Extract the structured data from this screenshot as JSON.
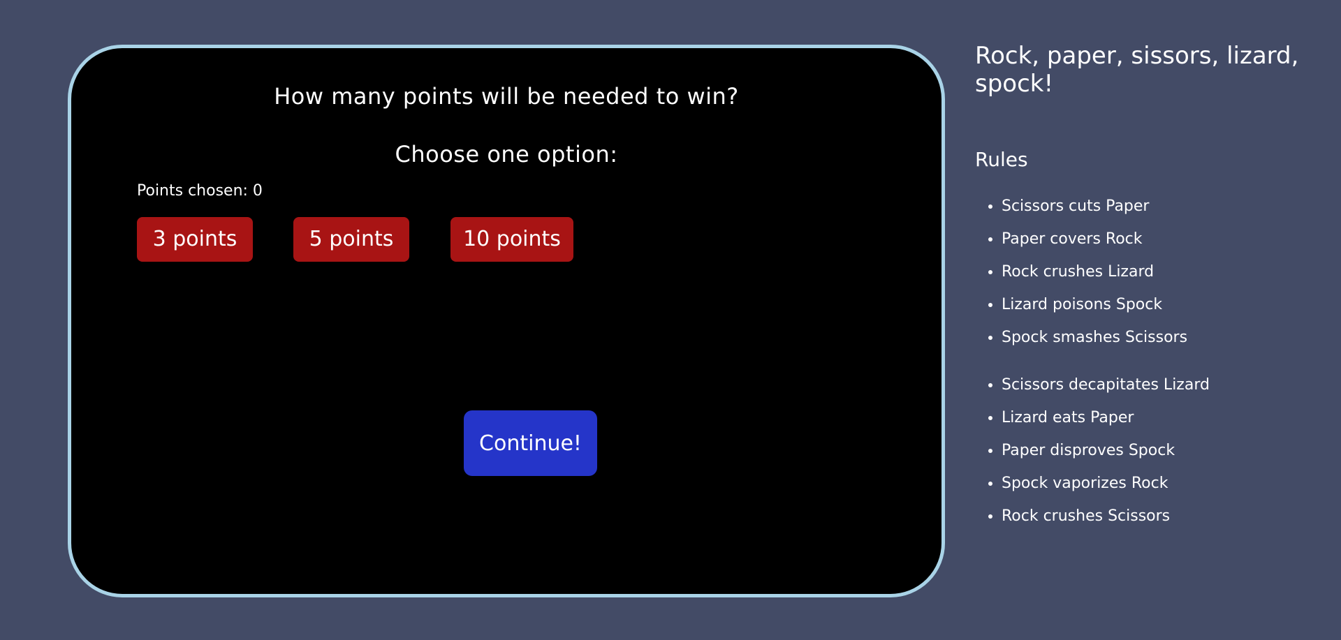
{
  "game": {
    "question": "How many points will be needed to win?",
    "choose": "Choose one option:",
    "points_chosen_label": "Points chosen: 0",
    "options": [
      {
        "label": "3 points"
      },
      {
        "label": "5 points"
      },
      {
        "label": "10 points"
      }
    ],
    "continue_label": "Continue!"
  },
  "sidebar": {
    "title": "Rock, paper, sissors, lizard, spock!",
    "rules_heading": "Rules",
    "rules_group_1": [
      "Scissors cuts Paper",
      "Paper covers Rock",
      "Rock crushes Lizard",
      "Lizard poisons Spock",
      "Spock smashes Scissors"
    ],
    "rules_group_2": [
      "Scissors decapitates Lizard",
      "Lizard eats Paper",
      "Paper disproves Spock",
      "Spock vaporizes Rock",
      "Rock crushes Scissors"
    ]
  },
  "colors": {
    "background": "#434b66",
    "panel_background": "#000000",
    "panel_border": "#a9d3e7",
    "option_button": "#a81414",
    "continue_button": "#2535c9",
    "text": "#ffffff"
  }
}
